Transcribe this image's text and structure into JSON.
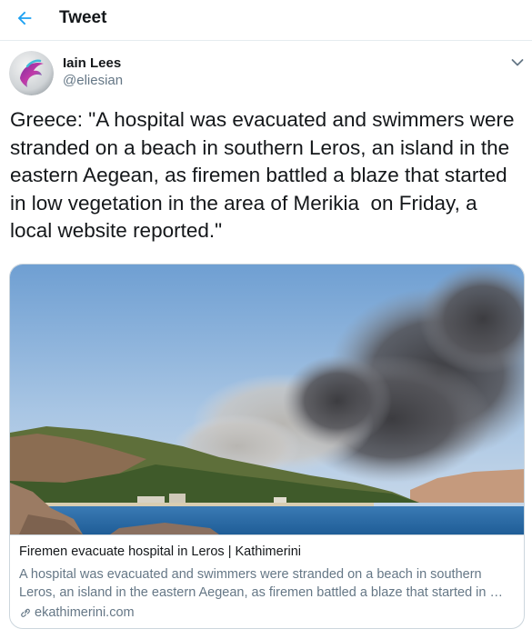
{
  "header": {
    "title": "Tweet",
    "back_icon": "arrow-left-icon",
    "accent_color": "#1da1f2"
  },
  "author": {
    "name": "Iain Lees",
    "handle": "@eliesian",
    "avatar_icon": "dolphin-logo-avatar"
  },
  "tweet": {
    "text": "Greece: \"A hospital was evacuated and swimmers were stranded on a beach in southern Leros, an island in the eastern Aegean, as firemen battled a blaze that started in low vegetation in the area of Merikia  on Friday, a local website reported.\""
  },
  "card": {
    "image_alt": "Smoke from wildfire over a coastal hill",
    "title": "Firemen evacuate hospital in Leros | Kathimerini",
    "description": "A hospital was evacuated and swimmers were stranded on a beach in southern Leros, an island in the eastern Aegean, as firemen battled a blaze that started in …",
    "domain": "ekathimerini.com",
    "domain_icon": "link-icon"
  },
  "colors": {
    "text_primary": "#14171a",
    "text_secondary": "#657786",
    "border": "#ccd6dd"
  }
}
